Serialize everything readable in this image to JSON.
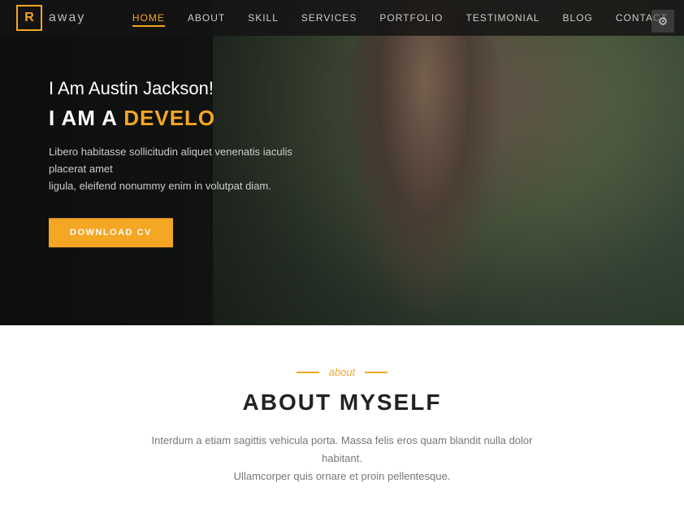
{
  "logo": {
    "icon_letter": "R",
    "brand_name": "away"
  },
  "nav": {
    "links": [
      {
        "label": "HOME",
        "active": true
      },
      {
        "label": "ABOUT",
        "active": false
      },
      {
        "label": "SKILL",
        "active": false
      },
      {
        "label": "SERVICES",
        "active": false
      },
      {
        "label": "PORTFOLIO",
        "active": false
      },
      {
        "label": "TESTIMONIAL",
        "active": false
      },
      {
        "label": "BLOG",
        "active": false
      },
      {
        "label": "CONTACT",
        "active": false
      }
    ]
  },
  "hero": {
    "greeting": "I Am Austin Jackson!",
    "title_prefix": "I AM A",
    "title_highlight": "DEVELO",
    "description_line1": "Libero habitasse sollicitudin aliquet venenatis iaculis placerat amet",
    "description_line2": "ligula, eleifend nonummy enim in volutpat diam.",
    "cta_button": "DOWNLOAD CV"
  },
  "about": {
    "tag": "about",
    "section_title": "ABOUT MYSELF",
    "description_line1": "Interdum a etiam sagittis vehicula porta. Massa felis eros quam blandit nulla dolor habitant.",
    "description_line2": "Ullamcorper quis ornare et proin pellentesque."
  },
  "icons": {
    "gear": "⚙"
  }
}
